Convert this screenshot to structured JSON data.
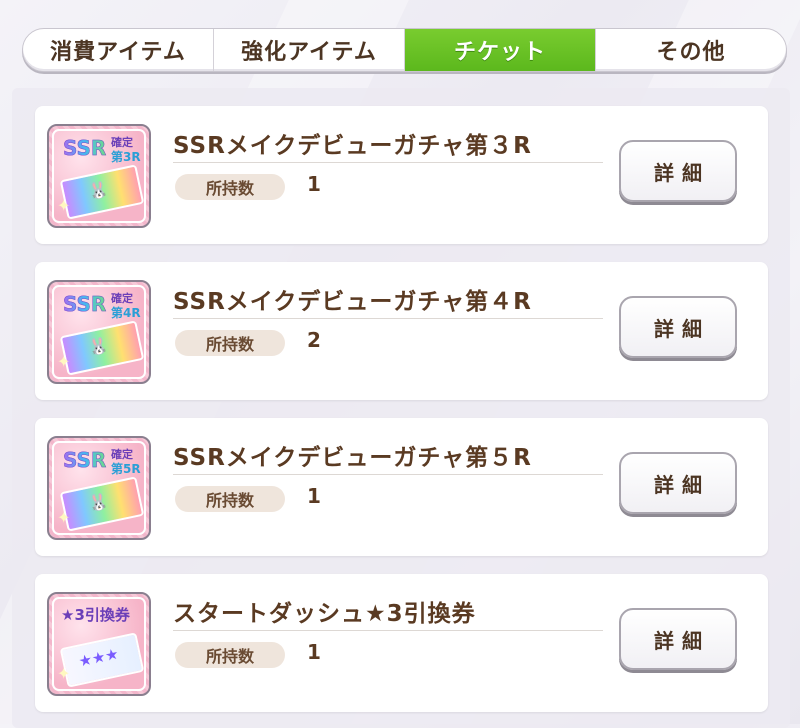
{
  "tabs": [
    {
      "label": "消費アイテム",
      "active": false
    },
    {
      "label": "強化アイテム",
      "active": false
    },
    {
      "label": "チケット",
      "active": true
    },
    {
      "label": "その他",
      "active": false
    }
  ],
  "count_label": "所持数",
  "detail_label": "詳細",
  "items": [
    {
      "title": "SSRメイクデビューガチャ第３R",
      "count": "1",
      "icon": "ssr-ticket-icon",
      "thumb_ssr": "SSR",
      "thumb_kakutei": "確定",
      "thumb_round": "第3R"
    },
    {
      "title": "SSRメイクデビューガチャ第４R",
      "count": "2",
      "icon": "ssr-ticket-icon",
      "thumb_ssr": "SSR",
      "thumb_kakutei": "確定",
      "thumb_round": "第4R"
    },
    {
      "title": "SSRメイクデビューガチャ第５R",
      "count": "1",
      "icon": "ssr-ticket-icon",
      "thumb_ssr": "SSR",
      "thumb_kakutei": "確定",
      "thumb_round": "第5R"
    },
    {
      "title": "スタートダッシュ★3引換券",
      "count": "1",
      "icon": "star3-exchange-ticket-icon",
      "thumb_title": "★3引換券"
    }
  ],
  "colors": {
    "active_tab": "#6cc428",
    "title_text": "#5a3a22"
  }
}
